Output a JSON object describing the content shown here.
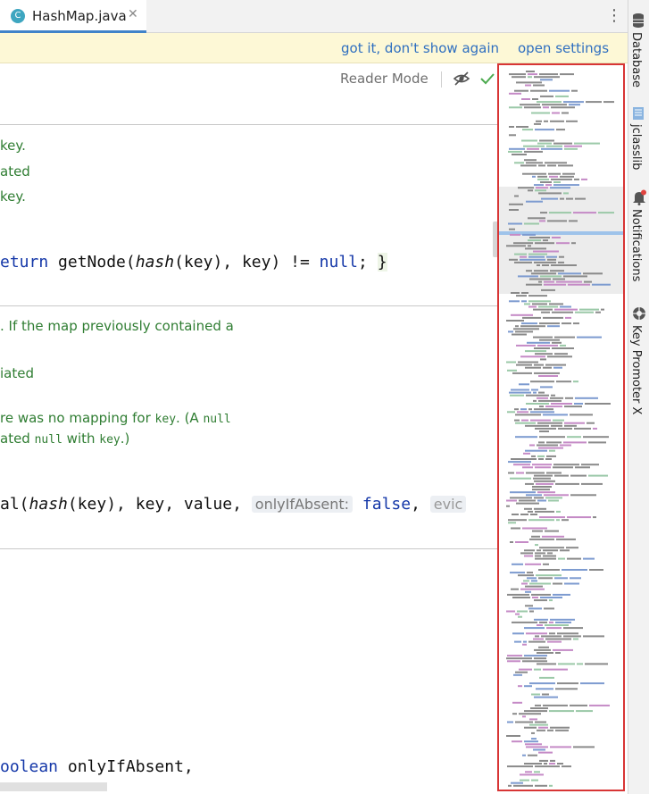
{
  "tab": {
    "icon_letter": "C",
    "filename": "HashMap.java",
    "close_glyph": "✕"
  },
  "more_glyph": "⋮",
  "banner": {
    "dismiss_link": "got it, don't show again",
    "settings_link": "open settings"
  },
  "reader_mode": "Reader Mode",
  "doc1": {
    "line1": "key.",
    "line2": "ated",
    "line3": "key."
  },
  "code1": {
    "kw_return": "eturn",
    "call": " getNode(",
    "hash": "hash",
    "args": "(key), key) != ",
    "null": "null",
    "semi": "; ",
    "brace": "}"
  },
  "doc2": {
    "line1": ". If the map previously contained a",
    "line2": "iated",
    "line3_prefix": "re was no mapping for ",
    "line3_key": "key",
    "line3_mid": ". (A ",
    "line3_null": "null",
    "line4_prefix": "ated ",
    "line4_null": "null",
    "line4_mid": " with ",
    "line4_key": "key",
    "line4_suffix": ".)"
  },
  "code2": {
    "prefix": "al(",
    "hash": "hash",
    "args": "(key), key, value, ",
    "hint": "onlyIfAbsent:",
    "false": "false",
    "comma": ", ",
    "tail": "evic"
  },
  "code3": {
    "kw": "oolean",
    "rest": " onlyIfAbsent,"
  },
  "sidebar": {
    "database": "Database",
    "jclasslib": "jclasslib",
    "notifications": "Notifications",
    "key_promoter": "Key Promoter X"
  },
  "colors": {
    "accent": "#4083c9",
    "doc_green": "#2f7d32",
    "keyword_blue": "#1437a8",
    "link": "#2f6fc0",
    "banner_bg": "#fdf8d6",
    "minimap_border": "#d83535"
  }
}
